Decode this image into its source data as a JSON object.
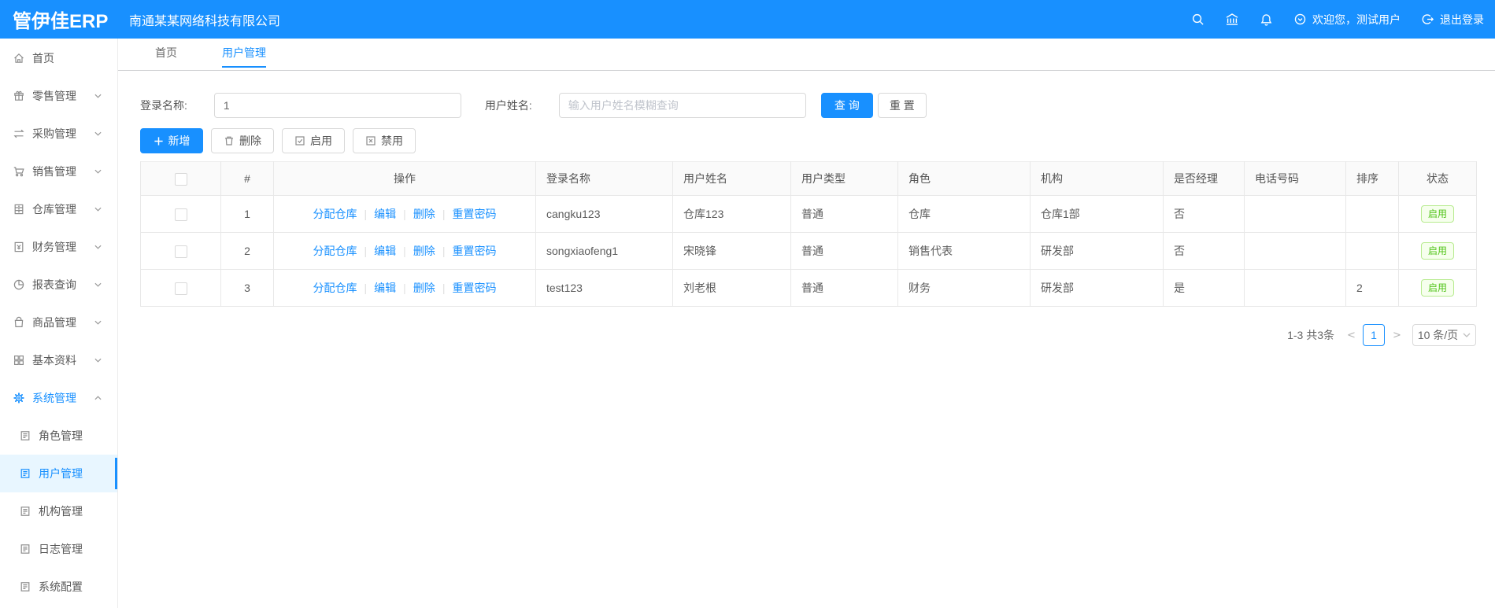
{
  "header": {
    "logo": "管伊佳ERP",
    "company": "南通某某网络科技有限公司",
    "welcome": "欢迎您，测试用户",
    "logout": "退出登录"
  },
  "sidebar": {
    "items": [
      {
        "label": "首页",
        "icon": "home",
        "name": "home"
      },
      {
        "label": "零售管理",
        "icon": "retail",
        "chevron": "down",
        "name": "retail"
      },
      {
        "label": "采购管理",
        "icon": "purchase",
        "chevron": "down",
        "name": "purchase"
      },
      {
        "label": "销售管理",
        "icon": "sales",
        "chevron": "down",
        "name": "sales"
      },
      {
        "label": "仓库管理",
        "icon": "warehouse",
        "chevron": "down",
        "name": "warehouse"
      },
      {
        "label": "财务管理",
        "icon": "finance",
        "chevron": "down",
        "name": "finance"
      },
      {
        "label": "报表查询",
        "icon": "report",
        "chevron": "down",
        "name": "report"
      },
      {
        "label": "商品管理",
        "icon": "product",
        "chevron": "down",
        "name": "product"
      },
      {
        "label": "基本资料",
        "icon": "base",
        "chevron": "down",
        "name": "base-data"
      },
      {
        "label": "系统管理",
        "icon": "gear",
        "chevron": "up",
        "name": "system",
        "open": true
      },
      {
        "label": "角色管理",
        "icon": "doc",
        "sub": true,
        "name": "role"
      },
      {
        "label": "用户管理",
        "icon": "doc",
        "sub": true,
        "selected": true,
        "name": "user"
      },
      {
        "label": "机构管理",
        "icon": "doc",
        "sub": true,
        "name": "org"
      },
      {
        "label": "日志管理",
        "icon": "doc",
        "sub": true,
        "name": "log"
      },
      {
        "label": "系统配置",
        "icon": "doc",
        "sub": true,
        "name": "config"
      }
    ]
  },
  "tabs": [
    {
      "label": "首页"
    },
    {
      "label": "用户管理",
      "active": true
    }
  ],
  "filters": {
    "login_label": "登录名称:",
    "login_value": "1",
    "name_label": "用户姓名:",
    "name_placeholder": "输入用户姓名模糊查询",
    "search": "查 询",
    "reset": "重 置"
  },
  "toolbar": {
    "add": "新增",
    "delete": "删除",
    "enable": "启用",
    "disable": "禁用"
  },
  "table": {
    "headers": [
      "#",
      "操作",
      "登录名称",
      "用户姓名",
      "用户类型",
      "角色",
      "机构",
      "是否经理",
      "电话号码",
      "排序",
      "状态"
    ],
    "op_links": [
      "分配仓库",
      "编辑",
      "删除",
      "重置密码"
    ],
    "rows": [
      {
        "index": "1",
        "login": "cangku123",
        "name": "仓库123",
        "type": "普通",
        "role": "仓库",
        "org": "仓库1部",
        "manager": "否",
        "phone": "",
        "sort": "",
        "status": "启用"
      },
      {
        "index": "2",
        "login": "songxiaofeng1",
        "name": "宋晓锋",
        "type": "普通",
        "role": "销售代表",
        "org": "研发部",
        "manager": "否",
        "phone": "",
        "sort": "",
        "status": "启用"
      },
      {
        "index": "3",
        "login": "test123",
        "name": "刘老根",
        "type": "普通",
        "role": "财务",
        "org": "研发部",
        "manager": "是",
        "phone": "",
        "sort": "2",
        "status": "启用"
      }
    ]
  },
  "pagination": {
    "total": "1-3 共3条",
    "prev": "<",
    "page": "1",
    "next": ">",
    "page_size": "10 条/页"
  }
}
